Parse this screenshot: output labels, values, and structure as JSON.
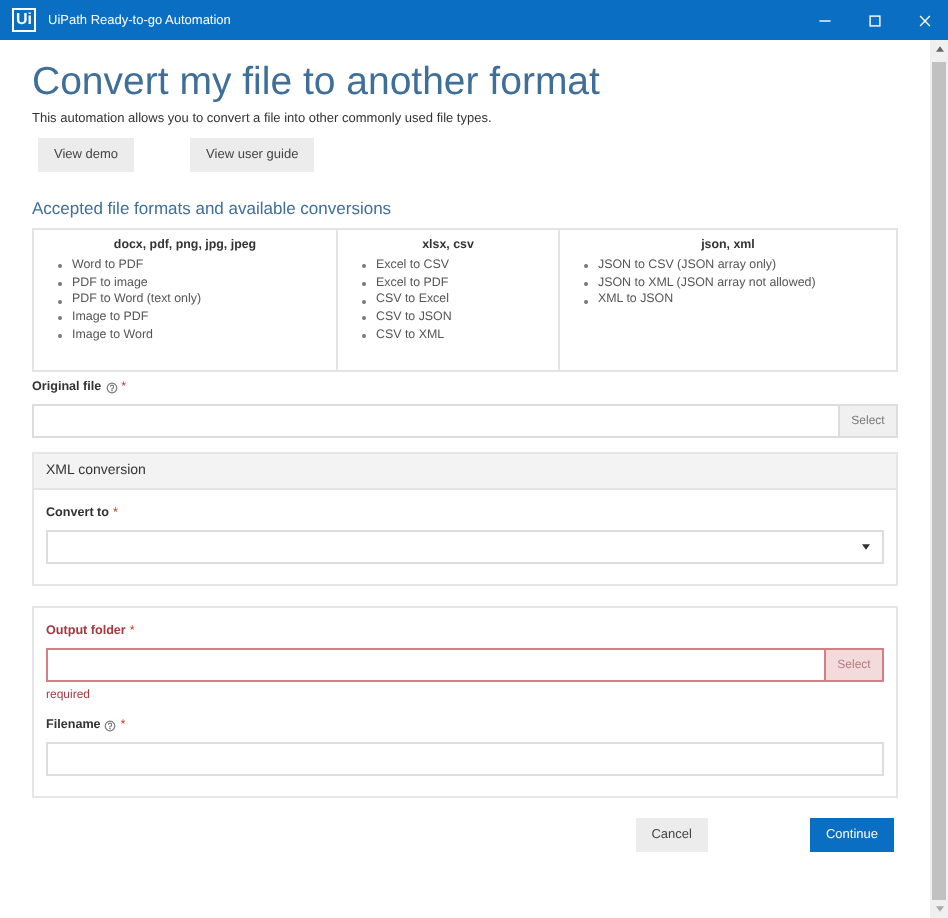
{
  "window": {
    "logo": "Ui",
    "title": "UiPath Ready-to-go Automation"
  },
  "heading": "Convert my file to another format",
  "description": "This automation allows you to convert a file into other commonly used file types.",
  "links": [
    "View demo",
    "View user guide"
  ],
  "formats": {
    "title": "Accepted file formats and available conversions",
    "columns": [
      {
        "heading": "docx, pdf, png, jpg, jpeg",
        "items": [
          "Word to PDF",
          "PDF to image",
          "PDF to Word (text only)",
          "Image to PDF",
          "Image to Word"
        ]
      },
      {
        "heading": "xlsx, csv",
        "items": [
          "Excel to CSV",
          "Excel to PDF",
          "CSV to Excel",
          "CSV to JSON",
          "CSV to XML"
        ]
      },
      {
        "heading": "json, xml",
        "items": [
          "JSON to CSV (JSON array only)",
          "JSON to XML (JSON array not allowed)",
          "XML to JSON"
        ]
      }
    ]
  },
  "original_file": {
    "kind": "file",
    "label": "Original file",
    "help": true,
    "mark": "*",
    "error": false,
    "button": "Select"
  },
  "panels": [
    {
      "title": "XML conversion",
      "fields": [
        {
          "kind": "select",
          "label": "Convert to",
          "help": false,
          "mark": "*",
          "error": false
        }
      ]
    },
    {
      "fields": [
        {
          "kind": "file",
          "label": "Output folder",
          "help": false,
          "mark": "*",
          "error": true,
          "button": "Select",
          "message": "required"
        },
        {
          "kind": "text",
          "label": "Filename",
          "help": true,
          "mark": "*",
          "error": false
        }
      ]
    }
  ],
  "actions": [
    {
      "label": "Cancel",
      "primary": false
    },
    {
      "label": "Continue",
      "primary": true
    }
  ]
}
